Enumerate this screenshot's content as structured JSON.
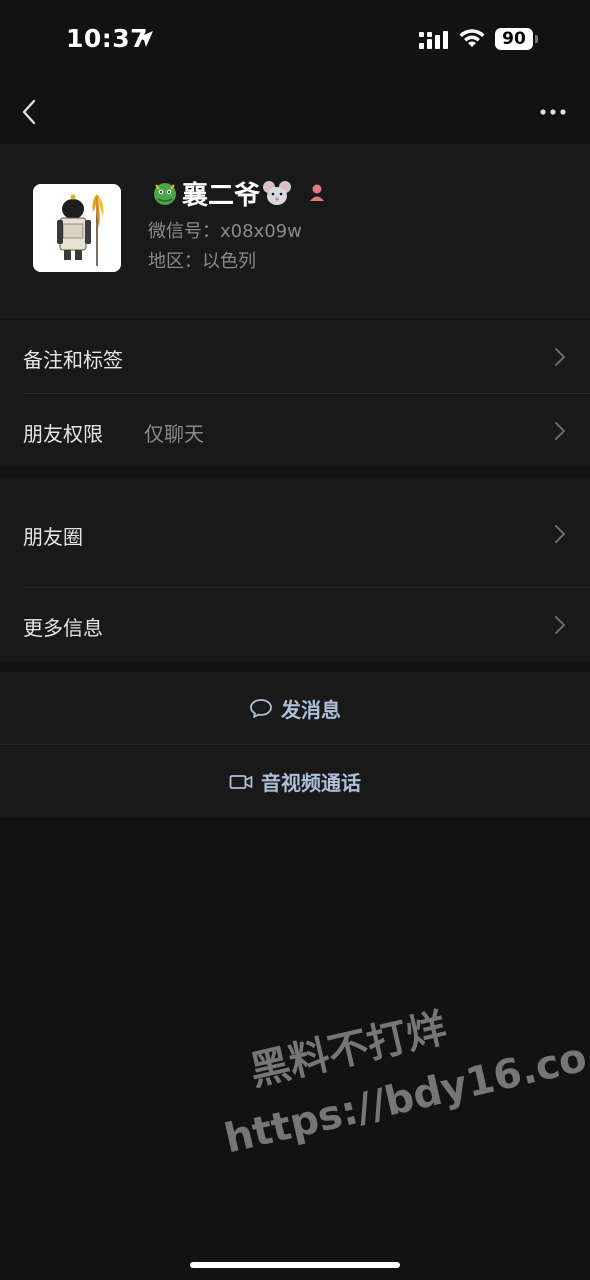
{
  "status_bar": {
    "time": "10:37",
    "battery": "90",
    "icons": [
      "location-arrow-icon",
      "cellular-signal-icon",
      "wifi-icon",
      "battery-icon"
    ]
  },
  "nav": {
    "back_icon": "chevron-left-icon",
    "more_icon": "ellipsis-icon"
  },
  "profile": {
    "name_prefix_emoji": "dragon-emoji",
    "name": "襄二爷",
    "name_suffix_emoji": "mouse-emoji",
    "gender_icon": "female-icon",
    "wechat_id": "微信号：x08x09w",
    "region": "地区：以色列"
  },
  "menu_group_1": {
    "items": [
      {
        "label": "备注和标签",
        "value": ""
      },
      {
        "label": "朋友权限",
        "value": "仅聊天"
      }
    ]
  },
  "menu_group_2": {
    "items": [
      {
        "label": "朋友圈"
      },
      {
        "label": "更多信息"
      }
    ]
  },
  "actions": {
    "send_message": "发消息",
    "av_call": "音视频通话"
  },
  "watermark": {
    "line1": "黑料不打烊",
    "line2": "https://bdy16.co"
  },
  "colors": {
    "background": "#121212",
    "surface": "#191919",
    "action_text": "#aebfd8",
    "secondary_text": "#8a8a8a"
  }
}
